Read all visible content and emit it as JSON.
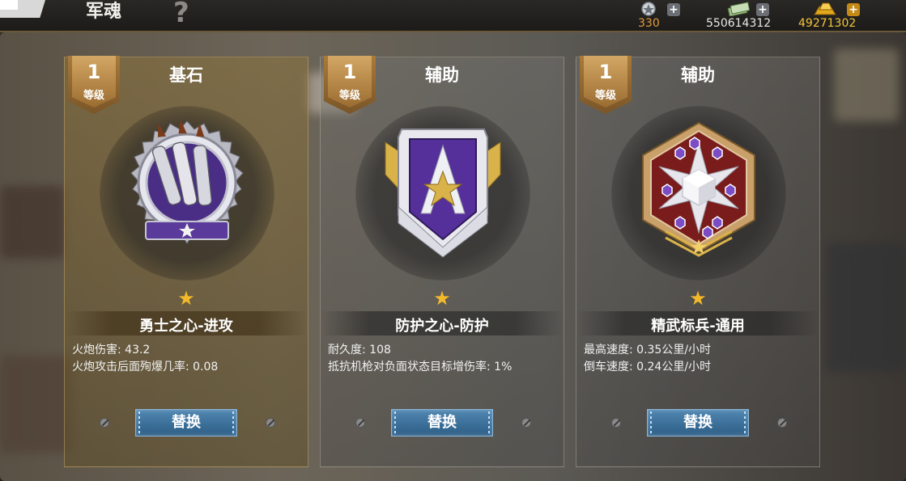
{
  "header": {
    "title": "军魂",
    "help_icon": "?"
  },
  "resources": [
    {
      "icon": "medal-token-icon",
      "value": "330",
      "color": "#e29b3e"
    },
    {
      "icon": "cash-icon",
      "value": "550614312",
      "color": "#e8e8e8"
    },
    {
      "icon": "gold-bar-icon",
      "value": "49271302",
      "color": "#f2c43a"
    }
  ],
  "plus_label": "+",
  "cards": [
    {
      "level": "1",
      "level_label": "等级",
      "slot_type": "基石",
      "star": "★",
      "medal_name": "勇士之心-进攻",
      "stats": [
        "火炮伤害: 43.2",
        "火炮攻击后面殉爆几率: 0.08"
      ],
      "button": "替换",
      "medal_icon": "shells-medal-icon"
    },
    {
      "level": "1",
      "level_label": "等级",
      "slot_type": "辅助",
      "star": "★",
      "medal_name": "防护之心-防护",
      "stats": [
        "耐久度: 108",
        "抵抗机枪对负面状态目标增伤率: 1%"
      ],
      "button": "替换",
      "medal_icon": "shield-star-medal-icon"
    },
    {
      "level": "1",
      "level_label": "等级",
      "slot_type": "辅助",
      "star": "★",
      "medal_name": "精武标兵-通用",
      "stats": [
        "最高速度: 0.35公里/小时",
        "倒车速度: 0.24公里/小时"
      ],
      "button": "替换",
      "medal_icon": "hexagon-cube-medal-icon"
    }
  ]
}
